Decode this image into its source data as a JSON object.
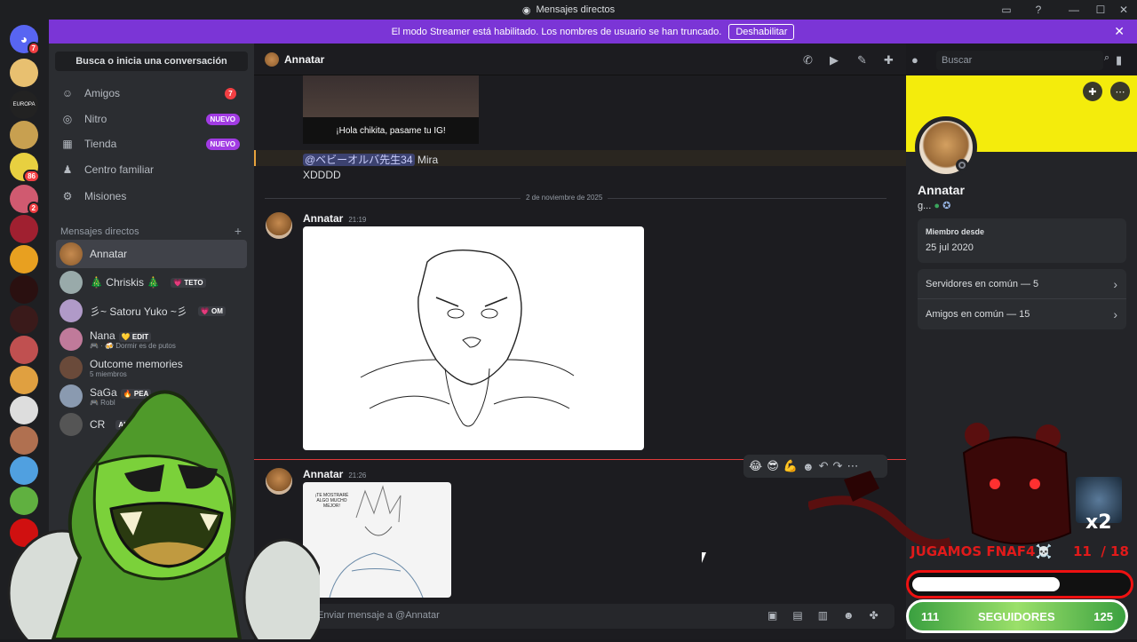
{
  "window": {
    "title": "Mensajes directos"
  },
  "streamer": {
    "message": "El modo Streamer está habilitado. Los nombres de usuario se han truncado.",
    "disable_label": "Deshabilitar"
  },
  "rail": {
    "home_badge": "7",
    "badges": [
      "86",
      "2"
    ]
  },
  "sidebar": {
    "search_label": "Busca o inicia una conversación",
    "nav": [
      {
        "label": "Amigos",
        "badge": "7"
      },
      {
        "label": "Nitro",
        "badge": "NUEVO"
      },
      {
        "label": "Tienda",
        "badge": "NUEVO"
      },
      {
        "label": "Centro familiar"
      },
      {
        "label": "Misiones"
      }
    ],
    "dm_header": "Mensajes directos",
    "dms": [
      {
        "name": "Annatar"
      },
      {
        "name": "🎄 Chriskis 🎄",
        "tag": "💗 TETO"
      },
      {
        "name": "彡~ Satoru Yuko ~彡",
        "tag": "💗 OM"
      },
      {
        "name": "Nana",
        "tag": "💛 EDIT",
        "sub": "🎮 · 🍻 Dormir es de putos"
      },
      {
        "name": "Outcome memories",
        "sub": "5 miembros"
      },
      {
        "name": "SaGa",
        "tag": "🔥 PEA",
        "sub": "🎮 Robl"
      },
      {
        "name": "CR",
        "tag": "AI"
      }
    ]
  },
  "chat": {
    "recipient": "Annatar",
    "image_caption": "¡Hola chikita, pasame tu IG!",
    "mention": "@ベビーオルバ先生34",
    "mention_text": "Mira",
    "line2": "XDDDD",
    "date_divider": "2 de noviembre de 2025",
    "messages": [
      {
        "author": "Annatar",
        "time": "21:19"
      },
      {
        "author": "Annatar",
        "time": "21:26"
      }
    ],
    "sketch2_bubble": "¡TE MOSTRARÉ ALGO MUCHO MEJOR!",
    "search_placeholder": "Buscar",
    "composer_placeholder": "Enviar mensaje a @Annatar",
    "reactions": [
      "😂",
      "😎",
      "💪"
    ]
  },
  "profile": {
    "name": "Annatar",
    "sub": "g...",
    "member_since_label": "Miembro desde",
    "member_since": "25 jul 2020",
    "mutual_servers": "Servidores en común — 5",
    "mutual_friends": "Amigos en común — 15"
  },
  "overlay": {
    "game_label": "JUGAMOS FNAF4☠️",
    "counter": "11  / 18",
    "multiplier": "x2",
    "followers_left": "111",
    "followers_label": "SEGUIDORES",
    "followers_right": "125",
    "follower_progress": 0.68
  },
  "colors": {
    "streamer_bar": "#7b35d6",
    "banner": "#f4ec0c",
    "nuevo": "#a13be3",
    "badge": "#f23f43"
  }
}
